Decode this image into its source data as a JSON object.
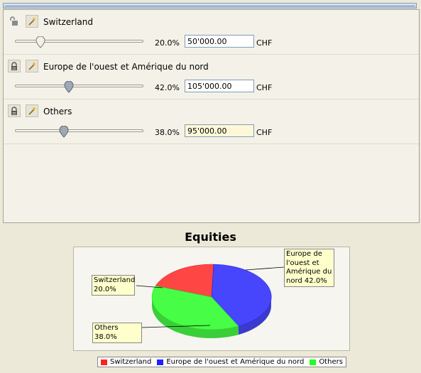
{
  "rows": [
    {
      "label": "Switzerland",
      "percent": "20.0%",
      "amount": "50'000.00",
      "currency": "CHF",
      "locked": false,
      "slider_fraction": 0.2,
      "focused": false
    },
    {
      "label": "Europe de l'ouest et Amérique du nord",
      "percent": "42.0%",
      "amount": "105'000.00",
      "currency": "CHF",
      "locked": true,
      "slider_fraction": 0.42,
      "focused": false
    },
    {
      "label": "Others",
      "percent": "38.0%",
      "amount": "95'000.00",
      "currency": "CHF",
      "locked": true,
      "slider_fraction": 0.38,
      "focused": true
    }
  ],
  "icons": {
    "unlocked": "unlock-icon",
    "locked": "lock-icon",
    "wand": "magic-wand-icon"
  },
  "chart_data": {
    "type": "pie",
    "title": "Equities",
    "slices": [
      {
        "name": "Switzerland",
        "value": 20.0,
        "color": "#ff2020"
      },
      {
        "name": "Europe de l'ouest et Amérique du nord",
        "value": 42.0,
        "color": "#2020ff"
      },
      {
        "name": "Others",
        "value": 38.0,
        "color": "#20ff20"
      }
    ],
    "callouts": {
      "switzerland": [
        "Switzerland",
        "20.0%"
      ],
      "europe": [
        "Europe de",
        "l'ouest et",
        "Amérique du",
        "nord 42.0%"
      ],
      "others": [
        "Others 38.0%"
      ]
    },
    "legend": [
      "Switzerland",
      "Europe de l'ouest et Amérique du nord",
      "Others"
    ],
    "legend_position": "bottom"
  }
}
